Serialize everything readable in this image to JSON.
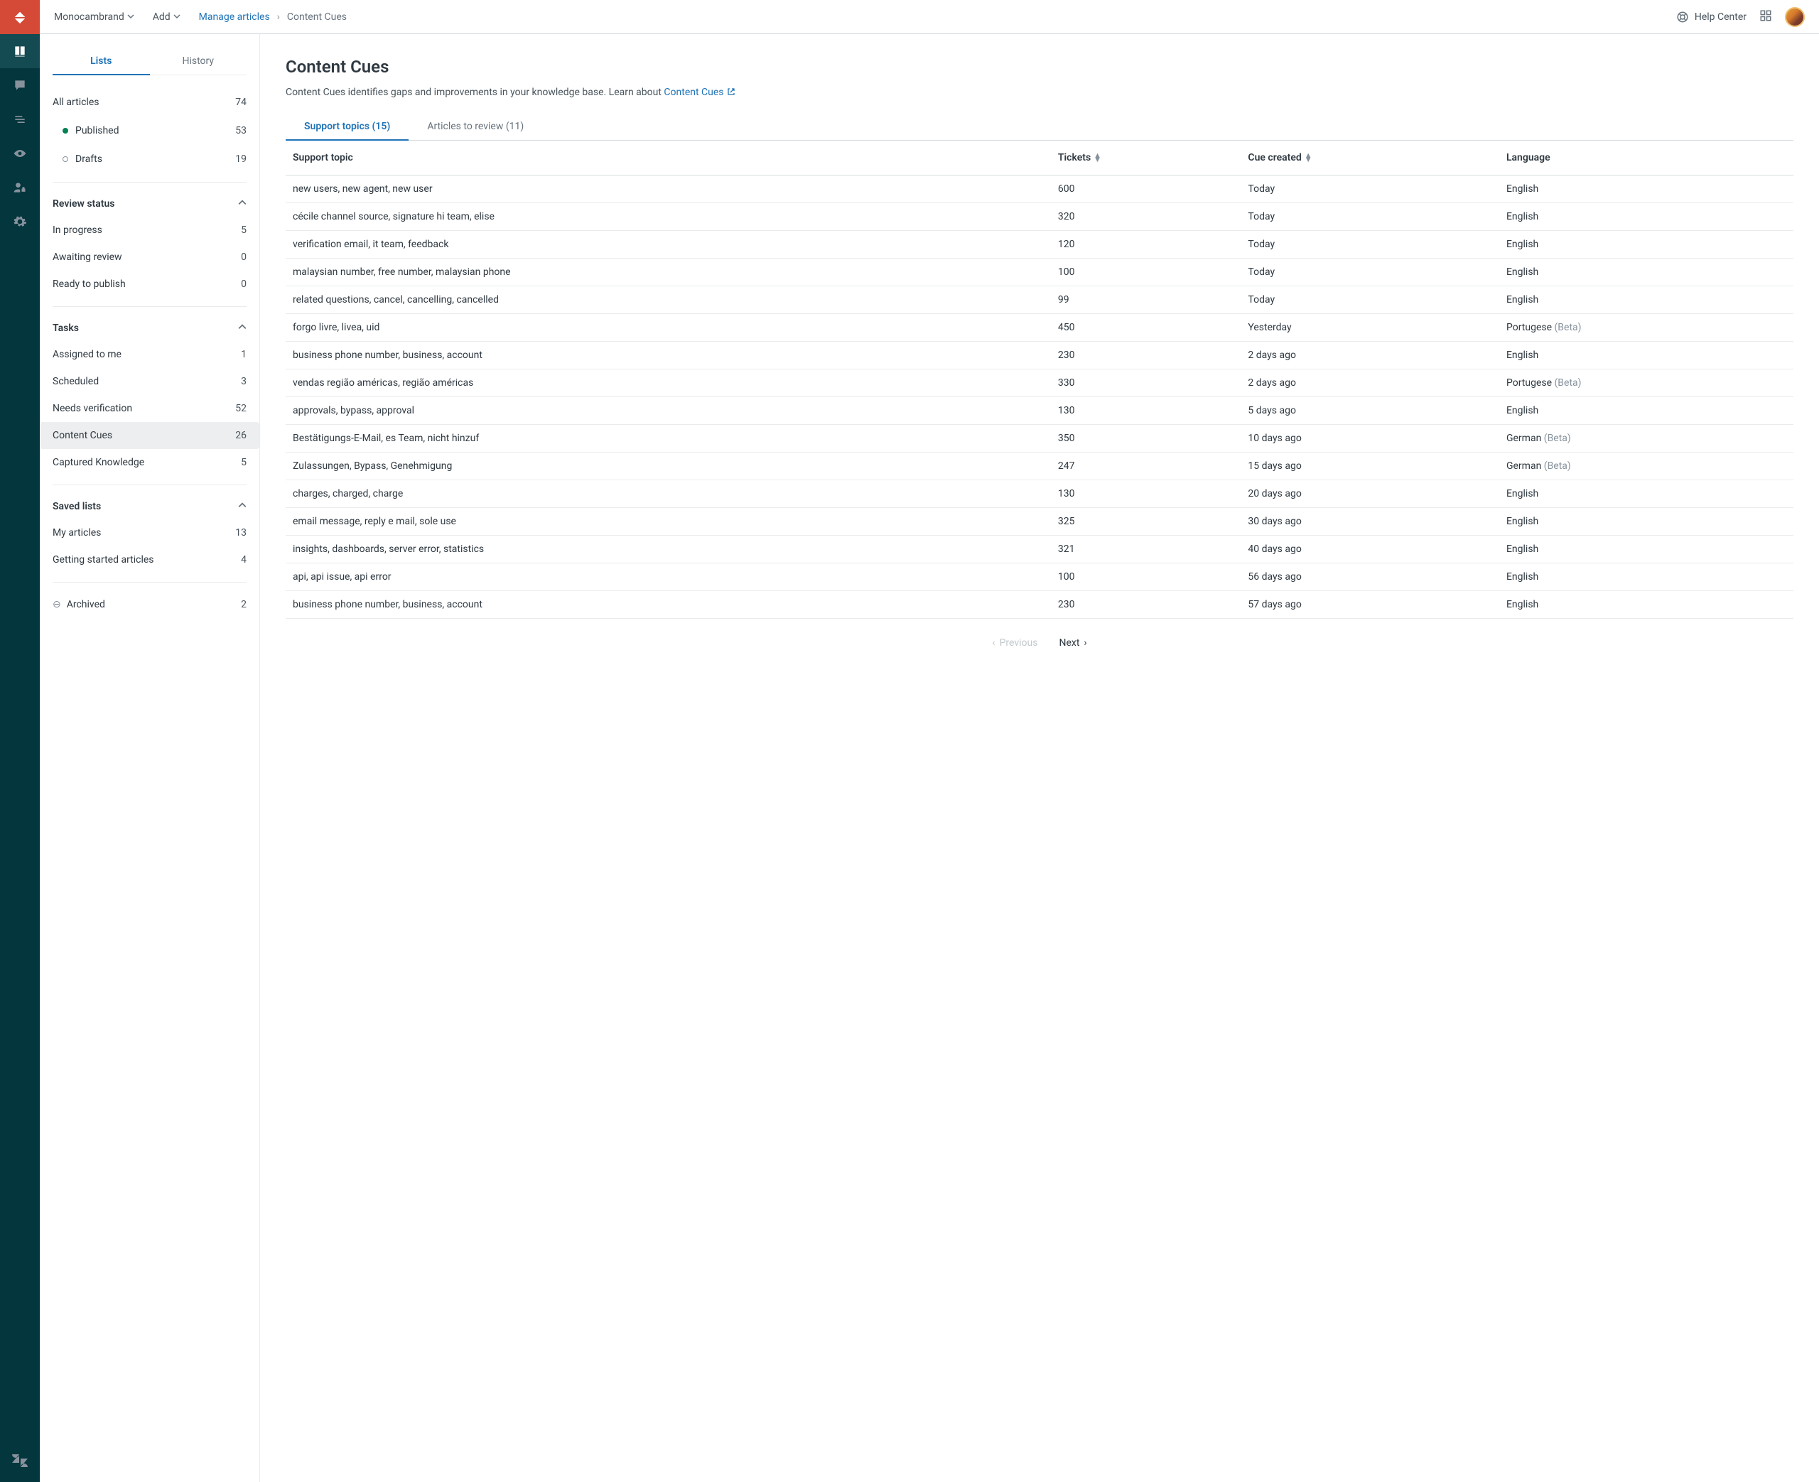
{
  "topbar": {
    "brand": "Monocambrand",
    "add": "Add",
    "crumb_manage": "Manage articles",
    "crumb_current": "Content Cues",
    "help_center": "Help Center"
  },
  "sidebar": {
    "tabs": {
      "lists": "Lists",
      "history": "History"
    },
    "all_articles": {
      "label": "All articles",
      "count": "74"
    },
    "published": {
      "label": "Published",
      "count": "53"
    },
    "drafts": {
      "label": "Drafts",
      "count": "19"
    },
    "review_header": "Review status",
    "review": [
      {
        "label": "In progress",
        "count": "5"
      },
      {
        "label": "Awaiting review",
        "count": "0"
      },
      {
        "label": "Ready to publish",
        "count": "0"
      }
    ],
    "tasks_header": "Tasks",
    "tasks": [
      {
        "label": "Assigned to me",
        "count": "1"
      },
      {
        "label": "Scheduled",
        "count": "3"
      },
      {
        "label": "Needs verification",
        "count": "52"
      },
      {
        "label": "Content Cues",
        "count": "26"
      },
      {
        "label": "Captured Knowledge",
        "count": "5"
      }
    ],
    "saved_header": "Saved lists",
    "saved": [
      {
        "label": "My articles",
        "count": "13"
      },
      {
        "label": "Getting started articles",
        "count": "4"
      }
    ],
    "archived": {
      "label": "Archived",
      "count": "2"
    }
  },
  "page": {
    "title": "Content Cues",
    "description_pre": "Content Cues identifies gaps and improvements in your knowledge base. Learn about ",
    "description_link": "Content Cues",
    "tab_support": "Support topics (15)",
    "tab_articles": "Articles to review (11)"
  },
  "table": {
    "headers": {
      "topic": "Support topic",
      "tickets": "Tickets",
      "created": "Cue created",
      "language": "Language"
    },
    "rows": [
      {
        "topic": "new users, new agent, new user",
        "tickets": "600",
        "created": "Today",
        "lang": "English",
        "beta": ""
      },
      {
        "topic": "cécile channel source, signature hi team, elise",
        "tickets": "320",
        "created": "Today",
        "lang": "English",
        "beta": ""
      },
      {
        "topic": "verification email, it team, feedback",
        "tickets": "120",
        "created": "Today",
        "lang": "English",
        "beta": ""
      },
      {
        "topic": "malaysian number, free number, malaysian phone",
        "tickets": "100",
        "created": "Today",
        "lang": "English",
        "beta": ""
      },
      {
        "topic": "related questions, cancel, cancelling, cancelled",
        "tickets": "99",
        "created": "Today",
        "lang": "English",
        "beta": ""
      },
      {
        "topic": "forgo livre, livea, uid",
        "tickets": "450",
        "created": "Yesterday",
        "lang": "Portugese",
        "beta": "(Beta)"
      },
      {
        "topic": "business phone number, business, account",
        "tickets": "230",
        "created": "2 days ago",
        "lang": "English",
        "beta": ""
      },
      {
        "topic": "vendas região américas, região américas",
        "tickets": "330",
        "created": "2 days ago",
        "lang": "Portugese",
        "beta": "(Beta)"
      },
      {
        "topic": "approvals, bypass, approval",
        "tickets": "130",
        "created": "5 days ago",
        "lang": "English",
        "beta": ""
      },
      {
        "topic": "Bestätigungs-E-Mail, es Team, nicht hinzuf",
        "tickets": "350",
        "created": "10 days ago",
        "lang": "German",
        "beta": "(Beta)"
      },
      {
        "topic": "Zulassungen, Bypass, Genehmigung",
        "tickets": "247",
        "created": "15 days ago",
        "lang": "German",
        "beta": "(Beta)"
      },
      {
        "topic": "charges, charged, charge",
        "tickets": "130",
        "created": "20 days ago",
        "lang": "English",
        "beta": ""
      },
      {
        "topic": "email message, reply e mail, sole use",
        "tickets": "325",
        "created": "30 days ago",
        "lang": "English",
        "beta": ""
      },
      {
        "topic": "insights, dashboards, server error, statistics",
        "tickets": "321",
        "created": "40 days ago",
        "lang": "English",
        "beta": ""
      },
      {
        "topic": "api, api issue, api error",
        "tickets": "100",
        "created": "56 days ago",
        "lang": "English",
        "beta": ""
      },
      {
        "topic": "business phone number, business, account",
        "tickets": "230",
        "created": "57 days ago",
        "lang": "English",
        "beta": ""
      }
    ]
  },
  "pager": {
    "prev": "Previous",
    "next": "Next"
  }
}
